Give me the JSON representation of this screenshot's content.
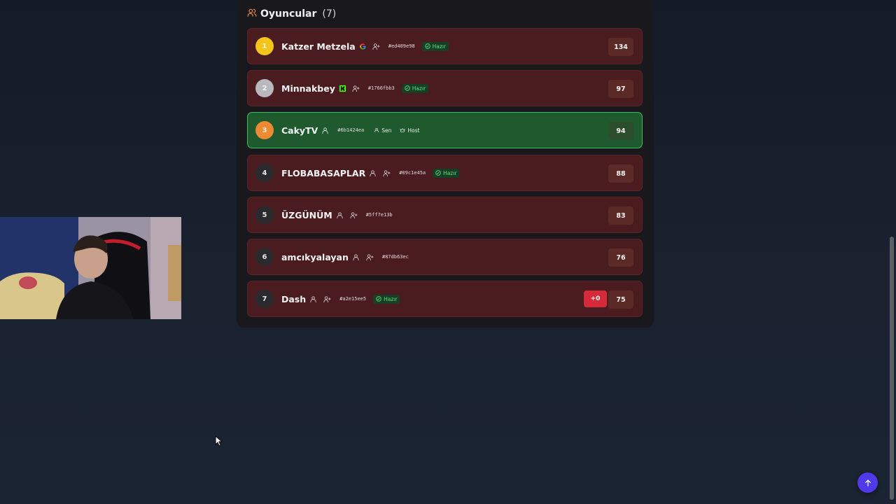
{
  "header": {
    "title": "Oyuncular",
    "count": "(7)"
  },
  "players": [
    {
      "rank": "1",
      "name": "Katzer Metzela",
      "provider": "google",
      "id": "#ed409e98",
      "ready": true,
      "ready_label": "Hazır",
      "score": "134"
    },
    {
      "rank": "2",
      "name": "Minnakbey",
      "provider": "kick",
      "id": "#1766fbb3",
      "ready": true,
      "ready_label": "Hazır",
      "score": "97"
    },
    {
      "rank": "3",
      "name": "CakyTV",
      "provider": "guest",
      "id": "#6b1424ea",
      "you_label": "Sen",
      "host_label": "Host",
      "score": "94"
    },
    {
      "rank": "4",
      "name": "FLOBABASAPLAR",
      "provider": "guest",
      "id": "#09c1e45a",
      "ready": true,
      "ready_label": "Hazır",
      "score": "88"
    },
    {
      "rank": "5",
      "name": "ÜZGÜNÜM",
      "provider": "guest",
      "id": "#5ff7e13b",
      "score": "83"
    },
    {
      "rank": "6",
      "name": "amcıkyalayan",
      "provider": "guest",
      "id": "#87db63ec",
      "score": "76"
    },
    {
      "rank": "7",
      "name": "Dash",
      "provider": "guest",
      "id": "#a2e15ee5",
      "ready": true,
      "ready_label": "Hazır",
      "delta": "+0",
      "score": "75"
    }
  ],
  "colors": {
    "row_bg": "#4a1c20",
    "me_bg": "#1f5a2f",
    "me_border": "#3dbb5b",
    "ready": "#5fe07f",
    "delta": "#d62a3a",
    "fab": "#4f39e8"
  },
  "icons": {
    "header": "users-icon",
    "scroll_top": "arrow-up-icon"
  }
}
